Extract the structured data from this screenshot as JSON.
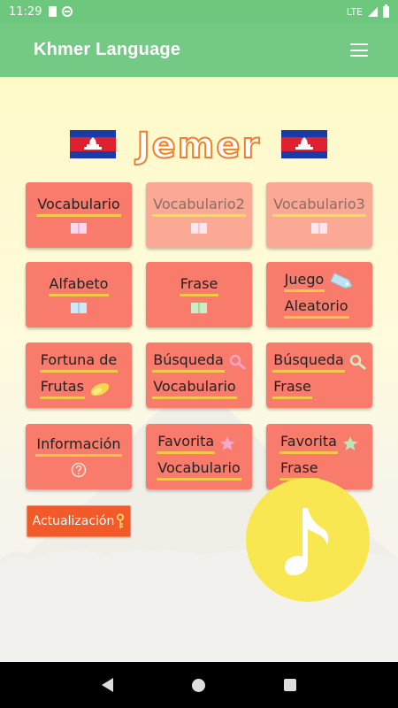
{
  "status_bar": {
    "time": "11:29",
    "network": "LTE"
  },
  "app_bar": {
    "title": "Khmer Language"
  },
  "header": {
    "title": "Jemer"
  },
  "menu": {
    "vocabulario": "Vocabulario",
    "vocabulario2": "Vocabulario2",
    "vocabulario3": "Vocabulario3",
    "alfabeto": "Alfabeto",
    "frase": "Frase",
    "juego_line1": "Juego",
    "juego_line2": "Aleatorio",
    "fortuna_line1": "Fortuna de",
    "fortuna_line2": "Frutas",
    "busqueda_vocab_line1": "Búsqueda",
    "busqueda_vocab_line2": "Vocabulario",
    "busqueda_frase_line1": "Búsqueda",
    "busqueda_frase_line2": "Frase",
    "informacion": "Información",
    "favorita_vocab_line1": "Favorita",
    "favorita_vocab_line2": "Vocabulario",
    "favorita_frase_line1": "Favorita",
    "favorita_frase_line2": "Frase"
  },
  "update_button": "Actualización",
  "icons": {
    "menu": "hamburger-menu-icon",
    "book": "book-icon",
    "tag": "tag-icon",
    "fruit": "fruit-icon",
    "search": "magnifier-icon",
    "info": "question-icon",
    "star_pink": "star-icon",
    "star_green": "star-icon",
    "key": "key-icon",
    "music": "music-note-icon"
  },
  "colors": {
    "app_bar": "#74c985",
    "card": "#f87b6c",
    "card_disabled": "#fba894",
    "underline": "#f5c84a",
    "update_button": "#f25a2a",
    "music_button": "#f8e750",
    "title_stroke": "#f08030"
  }
}
